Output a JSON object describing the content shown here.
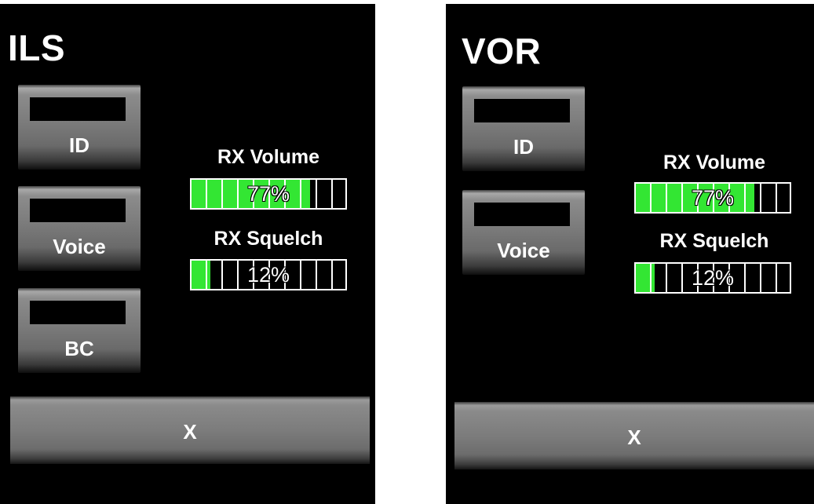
{
  "colors": {
    "panel_background": "#000000",
    "bar_fill": "#33e633",
    "text": "#ffffff"
  },
  "ils": {
    "title": "ILS",
    "buttons": {
      "id": "ID",
      "voice": "Voice",
      "bc": "BC"
    },
    "rx_volume": {
      "label": "RX Volume",
      "value_text": "77%",
      "value": 77
    },
    "rx_squelch": {
      "label": "RX Squelch",
      "value_text": "12%",
      "value": 12
    },
    "close_label": "X"
  },
  "vor": {
    "title": "VOR",
    "buttons": {
      "id": "ID",
      "voice": "Voice"
    },
    "rx_volume": {
      "label": "RX Volume",
      "value_text": "77%",
      "value": 77
    },
    "rx_squelch": {
      "label": "RX Squelch",
      "value_text": "12%",
      "value": 12
    },
    "close_label": "X"
  }
}
